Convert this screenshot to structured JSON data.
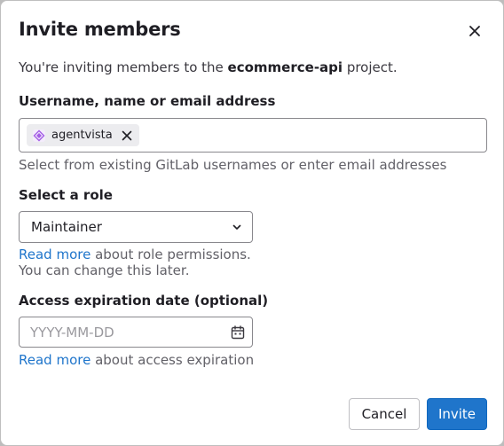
{
  "modal": {
    "title": "Invite members",
    "intro_prefix": "You're inviting members to the ",
    "project_name": "ecommerce-api",
    "intro_suffix": " project."
  },
  "username_field": {
    "label": "Username, name or email address",
    "tokens": [
      {
        "name": "agentvista",
        "avatar_icon": "diamond-avatar-icon"
      }
    ],
    "help": "Select from existing GitLab usernames or enter email addresses"
  },
  "role_field": {
    "label": "Select a role",
    "selected": "Maintainer",
    "help_link": "Read more",
    "help_text_1": " about role permissions.",
    "help_text_2": "You can change this later."
  },
  "expiration_field": {
    "label": "Access expiration date (optional)",
    "placeholder": "YYYY-MM-DD",
    "help_link": "Read more",
    "help_text": " about access expiration"
  },
  "footer": {
    "cancel_label": "Cancel",
    "invite_label": "Invite"
  },
  "colors": {
    "primary": "#1f75cb",
    "link": "#1f75cb",
    "avatar_accent": "#a45ee5"
  }
}
